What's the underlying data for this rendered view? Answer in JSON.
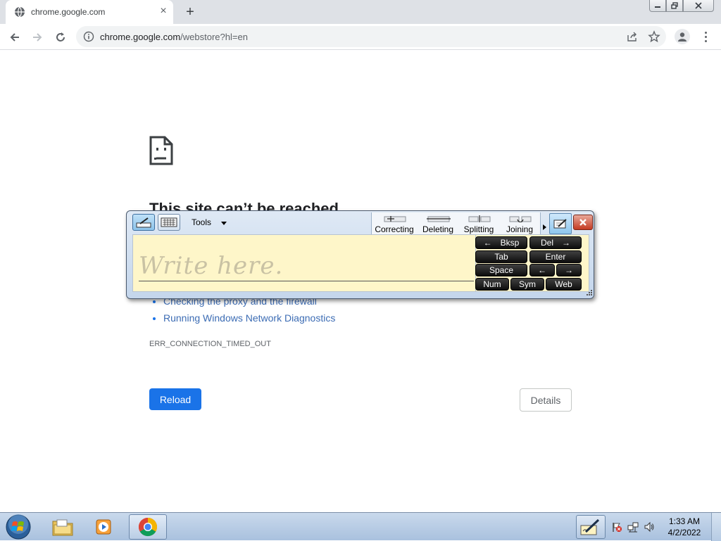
{
  "browser": {
    "tab_title": "chrome.google.com",
    "new_tab_symbol": "+",
    "tab_close_symbol": "×",
    "url_host": "chrome.google.com",
    "url_rest": "/webstore?hl=en"
  },
  "error_page": {
    "title": "This site can’t be reached",
    "suggestions": [
      "Checking the proxy and the firewall",
      "Running Windows Network Diagnostics"
    ],
    "error_code": "ERR_CONNECTION_TIMED_OUT",
    "reload_label": "Reload",
    "details_label": "Details"
  },
  "input_panel": {
    "tools_label": "Tools",
    "placeholder": "Write here.",
    "gestures": [
      "Correcting",
      "Deleting",
      "Splitting",
      "Joining"
    ],
    "keys": {
      "bksp": "Bksp",
      "bksp_arrow": "←",
      "del": "Del",
      "del_arrow": "→",
      "tab": "Tab",
      "enter": "Enter",
      "space": "Space",
      "left": "←",
      "right": "→",
      "num": "Num",
      "sym": "Sym",
      "web": "Web"
    }
  },
  "taskbar": {
    "time": "1:33 AM",
    "date": "4/2/2022"
  },
  "colors": {
    "accent": "#1a73e8",
    "link": "#3c6cb4",
    "write_area": "#fef6c9"
  }
}
